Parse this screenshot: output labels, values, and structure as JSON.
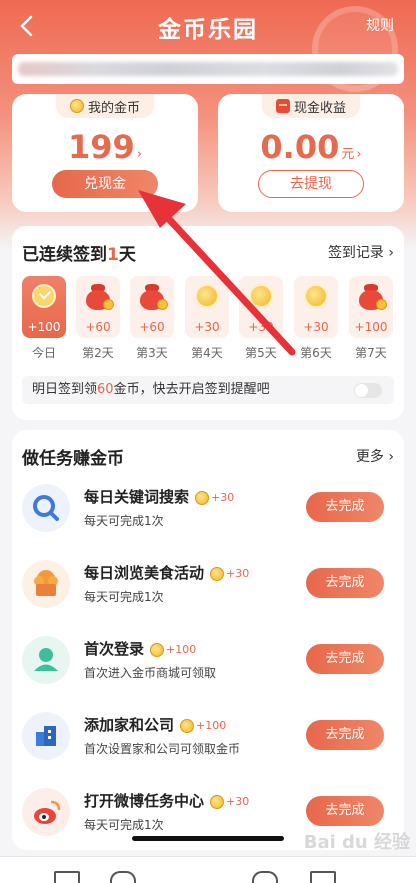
{
  "header": {
    "title": "金币乐园",
    "rules_label": "规则"
  },
  "notice": {
    "text": ""
  },
  "coins_card": {
    "label": "我的金币",
    "value": "199",
    "arrow": "›",
    "button": "兑现金"
  },
  "cash_card": {
    "label": "现金收益",
    "value": "0.00",
    "unit": "元",
    "arrow": "›",
    "button": "去提现"
  },
  "checkin": {
    "title_prefix": "已连续签到",
    "days_count": "1",
    "title_suffix": "天",
    "record_link": "签到记录 ›",
    "days": [
      {
        "label": "今日",
        "value": "+100",
        "icon": "check-icon",
        "active": true
      },
      {
        "label": "第2天",
        "value": "+60",
        "icon": "money-bag-icon",
        "active": false
      },
      {
        "label": "第3天",
        "value": "+60",
        "icon": "money-bag-icon",
        "active": false
      },
      {
        "label": "第4天",
        "value": "+30",
        "icon": "coin-icon",
        "active": false
      },
      {
        "label": "第5天",
        "value": "+30",
        "icon": "coin-icon",
        "active": false
      },
      {
        "label": "第6天",
        "value": "+30",
        "icon": "coin-icon",
        "active": false
      },
      {
        "label": "第7天",
        "value": "+100",
        "icon": "money-bag-icon",
        "active": false
      }
    ],
    "remind_prefix": "明日签到领",
    "remind_amount": "60",
    "remind_suffix": "金币，快去开启签到提醒吧",
    "remind_toggle": false
  },
  "tasks": {
    "title": "做任务赚金币",
    "more_link": "更多 ›",
    "items": [
      {
        "name": "每日关键词搜索",
        "reward": "+30",
        "desc": "每天可完成1次",
        "button": "去完成",
        "icon": "search-icon",
        "color": "#eef3fb"
      },
      {
        "name": "每日浏览美食活动",
        "reward": "+30",
        "desc": "每天可完成1次",
        "button": "去完成",
        "icon": "food-icon",
        "color": "#fdf1e6"
      },
      {
        "name": "首次登录",
        "reward": "+100",
        "desc": "首次进入金币商城可领取",
        "button": "去完成",
        "icon": "user-icon",
        "color": "#e8f6f1"
      },
      {
        "name": "添加家和公司",
        "reward": "+100",
        "desc": "首次设置家和公司可领取金币",
        "button": "去完成",
        "icon": "building-icon",
        "color": "#eef3fb"
      },
      {
        "name": "打开微博任务中心",
        "reward": "+30",
        "desc": "每天可完成1次",
        "button": "去完成",
        "icon": "weibo-icon",
        "color": "#fdeee9"
      }
    ]
  },
  "watermark": "Bai du 经验",
  "colors": {
    "accent": "#e8674b",
    "hero": "#ef6a52",
    "coin": "#f0b428"
  }
}
